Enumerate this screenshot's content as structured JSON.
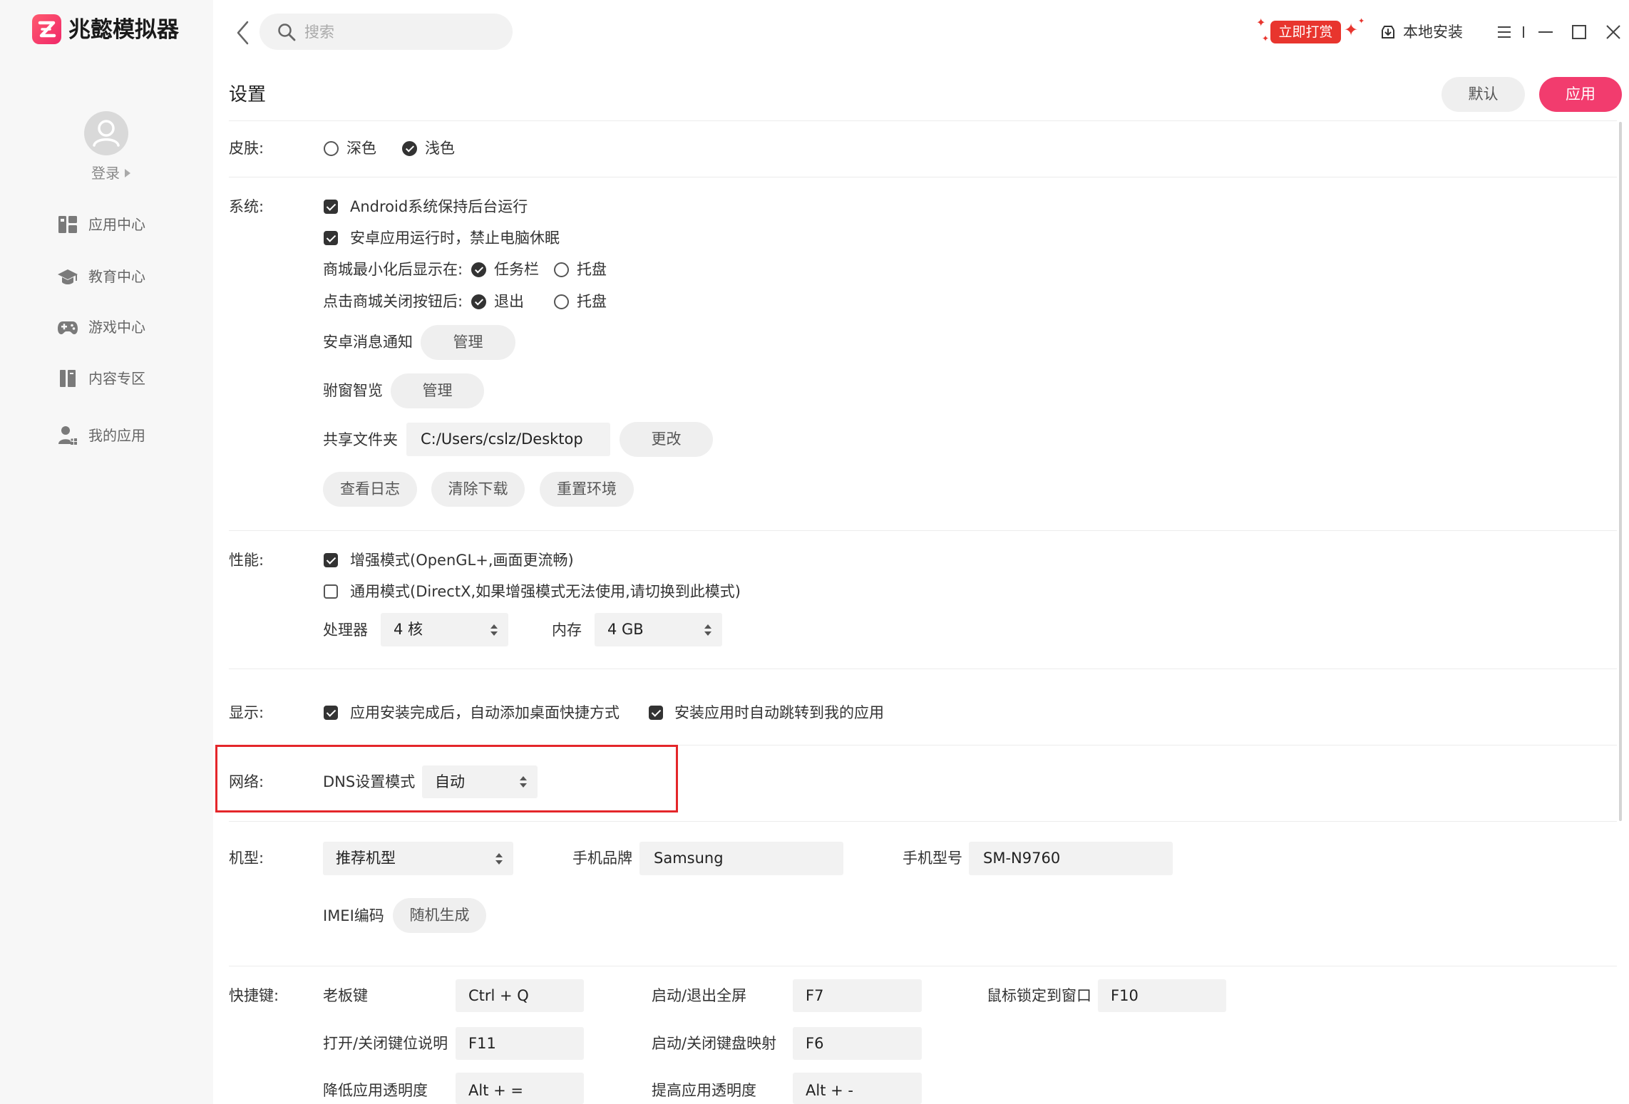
{
  "app": {
    "name": "兆懿模拟器"
  },
  "account": {
    "login_label": "登录"
  },
  "sidebar": {
    "items": [
      {
        "label": "应用中心",
        "icon": "app-center-icon"
      },
      {
        "label": "教育中心",
        "icon": "graduation-cap-icon"
      },
      {
        "label": "游戏中心",
        "icon": "gamepad-icon"
      },
      {
        "label": "内容专区",
        "icon": "books-icon"
      },
      {
        "label": "我的应用",
        "icon": "user-apps-icon"
      }
    ]
  },
  "topbar": {
    "search_placeholder": "搜索",
    "reward_label": "立即打赏",
    "local_install_label": "本地安装"
  },
  "page": {
    "title": "设置",
    "default_label": "默认",
    "apply_label": "应用"
  },
  "settings": {
    "skin": {
      "label": "皮肤:",
      "options": [
        {
          "label": "深色",
          "checked": false
        },
        {
          "label": "浅色",
          "checked": true
        }
      ]
    },
    "system": {
      "label": "系统:",
      "keep_background": {
        "label": "Android系统保持后台运行",
        "checked": true
      },
      "prevent_sleep": {
        "label": "安卓应用运行时，禁止电脑休眠",
        "checked": true
      },
      "minimize_to": {
        "label": "商城最小化后显示在:",
        "options": [
          {
            "label": "任务栏",
            "checked": true
          },
          {
            "label": "托盘",
            "checked": false
          }
        ]
      },
      "close_action": {
        "label": "点击商城关闭按钮后:",
        "options": [
          {
            "label": "退出",
            "checked": true
          },
          {
            "label": "托盘",
            "checked": false
          }
        ]
      },
      "notifications": {
        "label": "安卓消息通知",
        "button": "管理"
      },
      "smart_window": {
        "label": "驸窗智览",
        "button": "管理"
      },
      "shared_folder": {
        "label": "共享文件夹",
        "value": "C:/Users/cslz/Desktop",
        "button": "更改"
      },
      "actions": [
        "查看日志",
        "清除下载",
        "重置环境"
      ]
    },
    "performance": {
      "label": "性能:",
      "modes": [
        {
          "label": "增强模式(OpenGL+,画面更流畅)",
          "checked": true
        },
        {
          "label": "通用模式(DirectX,如果增强模式无法使用,请切换到此模式)",
          "checked": false
        }
      ],
      "cpu": {
        "label": "处理器",
        "value": "4 核"
      },
      "memory": {
        "label": "内存",
        "value": "4 GB"
      }
    },
    "display": {
      "label": "显示:",
      "options": [
        {
          "label": "应用安装完成后，自动添加桌面快捷方式",
          "checked": true
        },
        {
          "label": "安装应用时自动跳转到我的应用",
          "checked": true
        }
      ]
    },
    "network": {
      "label": "网络:",
      "dns_label": "DNS设置模式",
      "dns_value": "自动"
    },
    "device": {
      "label": "机型:",
      "model_select": "推荐机型",
      "brand_label": "手机品牌",
      "brand_value": "Samsung",
      "model_label": "手机型号",
      "model_value": "SM-N9760",
      "imei_label": "IMEI编码",
      "imei_button": "随机生成"
    },
    "hotkeys": {
      "label": "快捷键:",
      "items": [
        {
          "label": "老板键",
          "value": "Ctrl + Q"
        },
        {
          "label": "启动/退出全屏",
          "value": "F7"
        },
        {
          "label": "鼠标锁定到窗口",
          "value": "F10"
        },
        {
          "label": "打开/关闭键位说明",
          "value": "F11"
        },
        {
          "label": "启动/关闭键盘映射",
          "value": "F6"
        },
        {
          "label": "降低应用透明度",
          "value": "Alt + ="
        },
        {
          "label": "提高应用透明度",
          "value": "Alt + -"
        }
      ]
    }
  },
  "colors": {
    "accent": "#f23c6e",
    "reward": "#e8352e",
    "highlight": "#e4262a"
  }
}
